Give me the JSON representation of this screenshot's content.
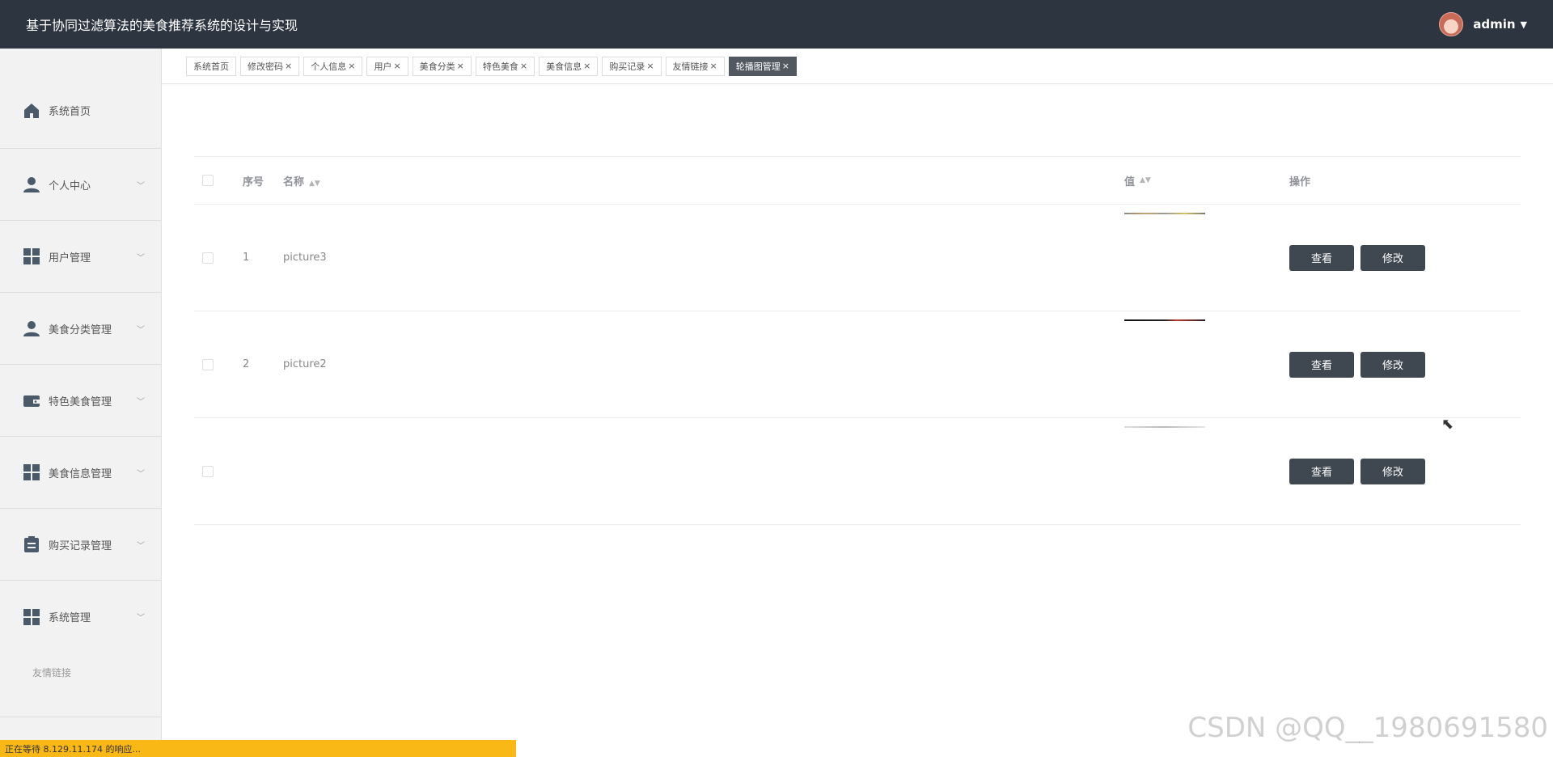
{
  "header": {
    "title": "基于协同过滤算法的美食推荐系统的设计与实现",
    "user": "admin"
  },
  "sidebar": {
    "items": [
      {
        "label": "系统首页",
        "icon": "home-icon"
      },
      {
        "label": "个人中心",
        "icon": "user-icon"
      },
      {
        "label": "用户管理",
        "icon": "grid-icon"
      },
      {
        "label": "美食分类管理",
        "icon": "user-icon"
      },
      {
        "label": "特色美食管理",
        "icon": "wallet-icon"
      },
      {
        "label": "美食信息管理",
        "icon": "grid-icon"
      },
      {
        "label": "购买记录管理",
        "icon": "clipboard-icon"
      },
      {
        "label": "系统管理",
        "icon": "grid-icon"
      }
    ],
    "submenu": "友情链接"
  },
  "tabs": [
    "系统首页",
    "修改密码",
    "个人信息",
    "用户",
    "美食分类",
    "特色美食",
    "美食信息",
    "购买记录",
    "友情链接",
    "轮播图管理"
  ],
  "table": {
    "headers": {
      "index": "序号",
      "name": "名称",
      "value": "值",
      "op": "操作"
    },
    "rows": [
      {
        "index": "1",
        "name": "picture3"
      },
      {
        "index": "2",
        "name": "picture2"
      },
      {
        "index": "",
        "name": ""
      }
    ],
    "view_label": "查看",
    "edit_label": "修改"
  },
  "status": "正在等待 8.129.11.174 的响应...",
  "watermark": "CSDN @QQ__1980691580",
  "colors": {
    "header_bg": "#2d3640",
    "button_bg": "#3f4750",
    "status_bg": "#f9b815"
  }
}
